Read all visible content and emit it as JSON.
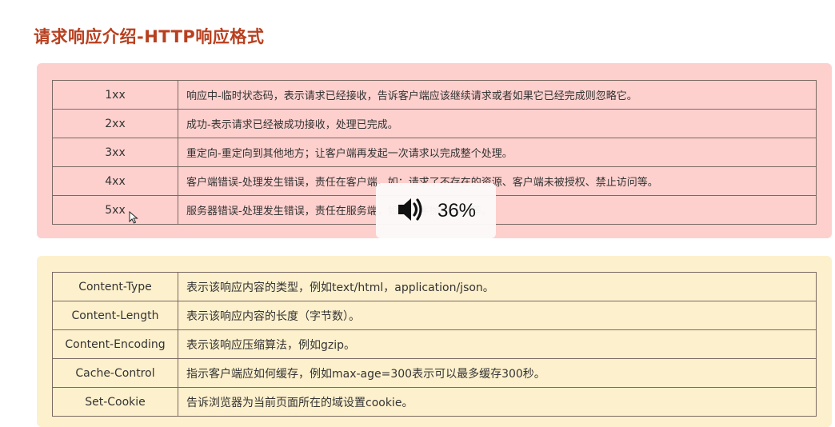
{
  "slide": {
    "title": "请求响应介绍-HTTP响应格式"
  },
  "status_codes": [
    {
      "code": "1xx",
      "desc": "响应中-临时状态码，表示请求已经接收，告诉客户端应该继续请求或者如果它已经完成则忽略它。"
    },
    {
      "code": "2xx",
      "desc": "成功-表示请求已经被成功接收，处理已完成。"
    },
    {
      "code": "3xx",
      "desc": "重定向-重定向到其他地方；让客户端再发起一次请求以完成整个处理。"
    },
    {
      "code": "4xx",
      "desc": "客户端错误-处理发生错误，责任在客户端，如：请求了不存在的资源、客户端未被授权、禁止访问等。"
    },
    {
      "code": "5xx",
      "desc": "服务器错误-处理发生错误，责任在服务端，如：程序抛出异常等。"
    }
  ],
  "headers": [
    {
      "name": "Content-Type",
      "desc": "表示该响应内容的类型，例如text/html，application/json。"
    },
    {
      "name": "Content-Length",
      "desc": "表示该响应内容的长度（字节数）。"
    },
    {
      "name": "Content-Encoding",
      "desc": "表示该响应压缩算法，例如gzip。"
    },
    {
      "name": "Cache-Control",
      "desc": "指示客户端应如何缓存，例如max-age=300表示可以最多缓存300秒。"
    },
    {
      "name": "Set-Cookie",
      "desc": "告诉浏览器为当前页面所在的域设置cookie。"
    }
  ],
  "volume_overlay": {
    "icon": "speaker-volume-icon",
    "label": "36%"
  },
  "colors": {
    "title": "#b8401f",
    "status_panel": "#fdd0cd",
    "header_panel": "#fdf0cc",
    "border": "#7a6a63"
  }
}
